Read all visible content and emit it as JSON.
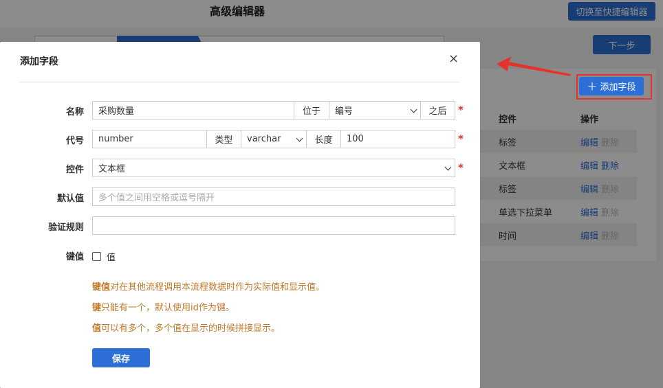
{
  "app": {
    "title": "高级编辑器",
    "switch_button": "切换至快捷编辑器",
    "next_button": "下一步",
    "add_field_button": "添加字段",
    "table": {
      "headers": [
        "控件",
        "操作"
      ],
      "rows": [
        {
          "control": "标签",
          "edit": "编辑",
          "delete": "删除",
          "delete_enabled": false
        },
        {
          "control": "文本框",
          "edit": "编辑",
          "delete": "删除",
          "delete_enabled": true
        },
        {
          "control": "标签",
          "edit": "编辑",
          "delete": "删除",
          "delete_enabled": false
        },
        {
          "control": "单选下拉菜单",
          "edit": "编辑",
          "delete": "删除",
          "delete_enabled": false
        },
        {
          "control": "时间",
          "edit": "编辑",
          "delete": "删除",
          "delete_enabled": false
        }
      ]
    }
  },
  "modal": {
    "title": "添加字段",
    "close": "×",
    "name": {
      "label": "名称",
      "value": "采购数量",
      "position_label": "位于",
      "position_value": "编号",
      "after_label": "之后",
      "required": "*"
    },
    "code": {
      "label": "代号",
      "value": "number",
      "type_label": "类型",
      "type_value": "varchar",
      "length_label": "长度",
      "length_value": "100",
      "required": "*"
    },
    "control": {
      "label": "控件",
      "value": "文本框",
      "required": "*"
    },
    "default": {
      "label": "默认值",
      "placeholder": "多个值之间用空格或逗号隔开"
    },
    "validation": {
      "label": "验证规则",
      "value": ""
    },
    "key": {
      "label": "键值",
      "checkbox_label": "值"
    },
    "hints": [
      {
        "bold": "键值",
        "text": "对在其他流程调用本流程数据时作为实际值和显示值。"
      },
      {
        "bold": "键",
        "text": "只能有一个，默认使用id作为键。"
      },
      {
        "bold": "值",
        "text": "可以有多个，多个值在显示的时候拼接显示。"
      }
    ],
    "save_button": "保存"
  },
  "colors": {
    "primary": "#2d6fd6",
    "required": "#e5322d",
    "hint": "#c07a2a"
  }
}
